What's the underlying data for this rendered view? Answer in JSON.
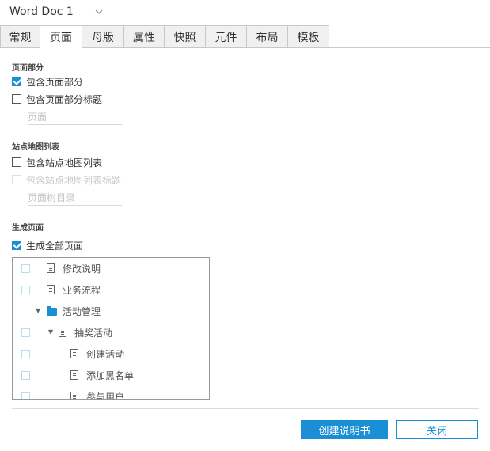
{
  "header": {
    "title": "Word Doc 1"
  },
  "tabs": [
    {
      "label": "常规"
    },
    {
      "label": "页面"
    },
    {
      "label": "母版"
    },
    {
      "label": "属性"
    },
    {
      "label": "快照"
    },
    {
      "label": "元件"
    },
    {
      "label": "布局"
    },
    {
      "label": "模板"
    }
  ],
  "active_tab": "页面",
  "page_section": {
    "title": "页面部分",
    "include_pages": {
      "label": "包含页面部分",
      "checked": true
    },
    "include_title": {
      "label": "包含页面部分标题",
      "checked": false
    },
    "title_placeholder": "页面"
  },
  "sitemap_section": {
    "title": "站点地图列表",
    "include_sitemap": {
      "label": "包含站点地图列表",
      "checked": false
    },
    "include_sitemap_title": {
      "label": "包含站点地图列表标题",
      "checked": false,
      "disabled": true
    },
    "title_placeholder": "页面树目录"
  },
  "generate_section": {
    "title": "生成页面",
    "generate_all": {
      "label": "生成全部页面",
      "checked": true
    }
  },
  "tree": [
    {
      "label": "修改说明",
      "type": "page",
      "checkbox": true
    },
    {
      "label": "业务流程",
      "type": "page",
      "checkbox": true
    },
    {
      "label": "活动管理",
      "type": "folder",
      "checkbox": false,
      "expanded": true
    },
    {
      "label": "抽奖活动",
      "type": "page",
      "checkbox": true,
      "expanded": true
    },
    {
      "label": "创建活动",
      "type": "page",
      "checkbox": true
    },
    {
      "label": "添加黑名单",
      "type": "page",
      "checkbox": true
    },
    {
      "label": "参与用户",
      "type": "page",
      "checkbox": true
    }
  ],
  "buttons": {
    "create": "创建说明书",
    "close": "关闭"
  },
  "colors": {
    "accent": "#1a8fd6"
  }
}
